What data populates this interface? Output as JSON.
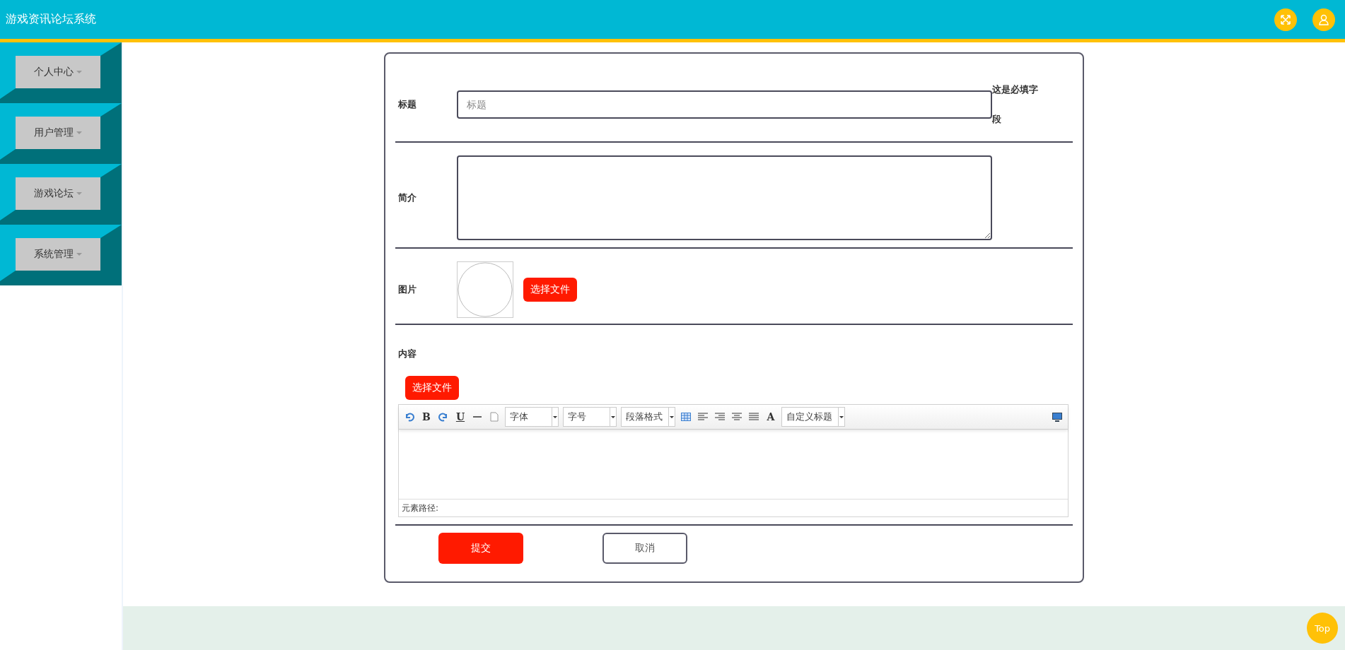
{
  "header": {
    "title": "游戏资讯论坛系统"
  },
  "sidebar": {
    "items": [
      {
        "label": "个人中心"
      },
      {
        "label": "用户管理"
      },
      {
        "label": "游戏论坛"
      },
      {
        "label": "系统管理"
      }
    ]
  },
  "form": {
    "fields": [
      {
        "kind": "text",
        "label": "标题",
        "placeholder": "标题",
        "note": "这是必填字段"
      },
      {
        "kind": "textarea",
        "label": "简介"
      },
      {
        "kind": "image",
        "label": "图片",
        "button": "选择文件"
      },
      {
        "kind": "editor",
        "label": "内容",
        "button": "选择文件",
        "toolbar": [
          {
            "kind": "icon"
          },
          {
            "kind": "glyph",
            "text": "B"
          },
          {
            "kind": "icon"
          },
          {
            "kind": "glyph",
            "text": "U"
          },
          {
            "kind": "icon"
          },
          {
            "kind": "icon"
          },
          {
            "kind": "select",
            "text": "字体"
          },
          {
            "kind": "select",
            "text": "字号"
          },
          {
            "kind": "select",
            "text": "段落格式"
          },
          {
            "kind": "icon"
          },
          {
            "kind": "icon"
          },
          {
            "kind": "icon"
          },
          {
            "kind": "icon"
          },
          {
            "kind": "icon"
          },
          {
            "kind": "glyph",
            "text": "A"
          },
          {
            "kind": "select",
            "text": "自定义标题"
          },
          {
            "kind": "icon"
          }
        ],
        "path_label": "元素路径:"
      }
    ],
    "buttons": [
      {
        "kind": "primary",
        "label": "提交"
      },
      {
        "kind": "secondary",
        "label": "取消"
      }
    ]
  },
  "top_button": {
    "label": "Top"
  }
}
